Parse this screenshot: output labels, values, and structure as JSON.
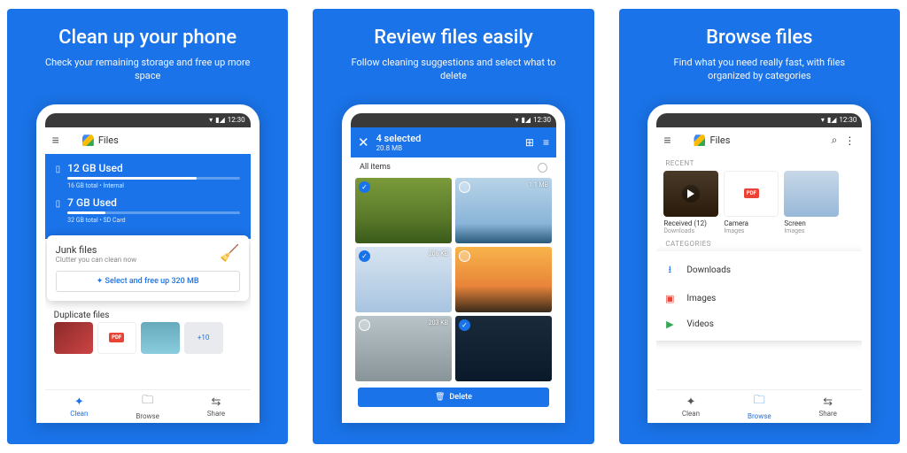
{
  "status_time": "12:30",
  "app_name": "Files",
  "panels": [
    {
      "title": "Clean up your phone",
      "subtitle": "Check your remaining storage and free up more space"
    },
    {
      "title": "Review files easily",
      "subtitle": "Follow cleaning suggestions and select what to delete"
    },
    {
      "title": "Browse files",
      "subtitle": "Find what you need really fast, with files organized by categories"
    }
  ],
  "clean": {
    "storage": [
      {
        "title": "12 GB Used",
        "sub": "16 GB total • Internal",
        "pct": 75
      },
      {
        "title": "7 GB Used",
        "sub": "32 GB total • SD Card",
        "pct": 22
      }
    ],
    "junk": {
      "title": "Junk files",
      "sub": "Clutter you can clean now",
      "button": "Select and free up 320 MB"
    },
    "dup": {
      "title": "Duplicate files",
      "more": "+10"
    }
  },
  "review": {
    "close": "✕",
    "count": "4 selected",
    "size": "20.8 MB",
    "all": "All items",
    "items": [
      {
        "sel": true,
        "size": ""
      },
      {
        "sel": false,
        "size": "1.1 MB"
      },
      {
        "sel": true,
        "size": "206 KB"
      },
      {
        "sel": false,
        "size": ""
      },
      {
        "sel": false,
        "size": "203 KB"
      },
      {
        "sel": true,
        "size": ""
      }
    ],
    "delete": "Delete"
  },
  "browse": {
    "recent_label": "RECENT",
    "recent": [
      {
        "t": "Received (12)",
        "s": "Downloads"
      },
      {
        "t": "Camera",
        "s": "Images"
      },
      {
        "t": "Screen",
        "s": "Images"
      }
    ],
    "cat_label": "CATEGORIES",
    "cats": [
      {
        "icon": "⭳",
        "color": "#1a73e8",
        "label": "Downloads"
      },
      {
        "icon": "▣",
        "color": "#ea4335",
        "label": "Images"
      },
      {
        "icon": "▶",
        "color": "#34a853",
        "label": "Videos"
      }
    ]
  },
  "nav": [
    {
      "icon": "✦",
      "label": "Clean"
    },
    {
      "icon": "🗀",
      "label": "Browse"
    },
    {
      "icon": "⇆",
      "label": "Share"
    }
  ]
}
